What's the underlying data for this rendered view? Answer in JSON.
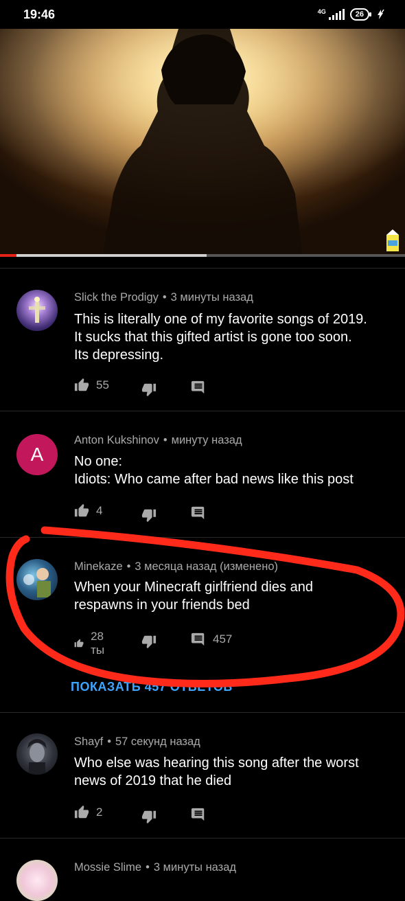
{
  "status_bar": {
    "time": "19:46",
    "network": "4G",
    "battery": "26"
  },
  "video": {
    "played_fraction": 0.04,
    "buffered_fraction": 0.51,
    "thumbnail_icon": "lemonade-carton-icon"
  },
  "comments": [
    {
      "author": "Slick the Prodigy",
      "time": "3 минуты назад",
      "lines": [
        "This is literally one of my favorite songs of 2019.",
        "It sucks that this gifted artist is gone too soon.",
        "Its depressing."
      ],
      "likes": "55",
      "replies": ""
    },
    {
      "author": "Anton Kukshinov",
      "time": "минуту назад",
      "avatar_letter": "A",
      "lines": [
        "No one:",
        "Idiots: Who came after bad news like this post"
      ],
      "likes": "4",
      "replies": ""
    },
    {
      "author": "Minekaze",
      "time": "3 месяца назад (изменено)",
      "lines": [
        "When your Minecraft girlfriend dies and",
        "respawns in your friends bed"
      ],
      "likes": "28 ты",
      "replies": "457",
      "show_replies_label": "ПОКАЗАТЬ 457 ОТВЕТОВ"
    },
    {
      "author": "Shayf",
      "time": "57 секунд назад",
      "lines": [
        "Who else was hearing this song after the worst",
        "news of 2019 that he died"
      ],
      "likes": "2",
      "replies": ""
    },
    {
      "author": "Mossie Slime",
      "time": "3 минуты назад",
      "lines": [],
      "likes": "",
      "replies": ""
    }
  ],
  "colors": {
    "accent_link": "#3ea6ff",
    "annotation": "#ff2a1a",
    "avatar_letter_bg": "#c2185b"
  }
}
